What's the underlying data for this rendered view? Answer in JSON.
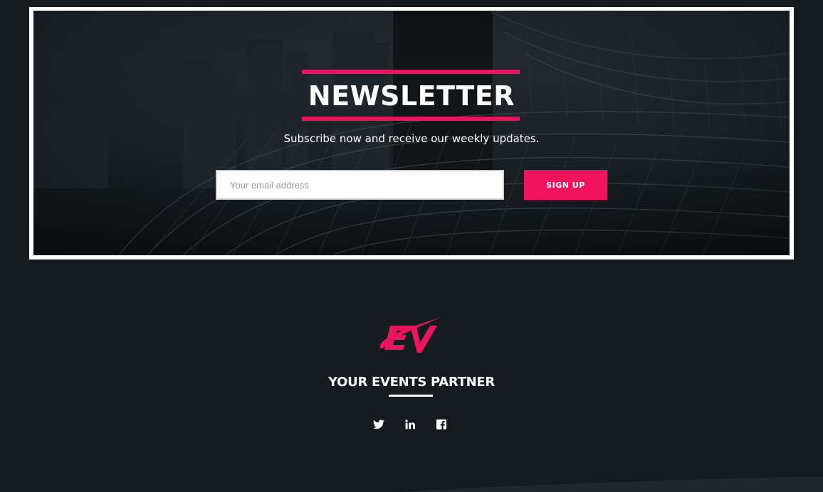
{
  "newsletter": {
    "title": "NEWSLETTER",
    "subtitle": "Subscribe now and receive our weekly updates.",
    "email_placeholder": "Your email address",
    "email_value": "",
    "signup_label": "SIGN UP"
  },
  "footer": {
    "logo_text": "EV",
    "tagline": "YOUR EVENTS PARTNER",
    "social": [
      {
        "icon": "twitter-icon"
      },
      {
        "icon": "linkedin-icon"
      },
      {
        "icon": "facebook-icon"
      }
    ]
  },
  "colors": {
    "accent": "#f2135f",
    "background": "#151a1f",
    "frame": "#ffffff"
  }
}
